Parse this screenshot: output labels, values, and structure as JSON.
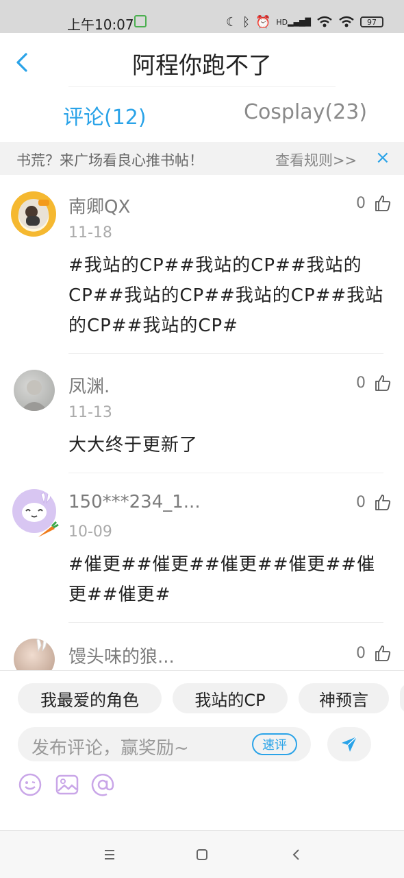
{
  "status_bar": {
    "time": "上午10:07",
    "battery": "97",
    "hd_label": "HD"
  },
  "header": {
    "title": "阿程你跑不了",
    "back_icon": "chevron-left-icon"
  },
  "tabs": [
    {
      "label": "评论(12)",
      "active": true
    },
    {
      "label": "Cosplay(23)",
      "active": false
    }
  ],
  "notice": {
    "text": "书荒？来广场看良心推书帖！",
    "link": "查看规则>>",
    "close": "×"
  },
  "comments": [
    {
      "user": "南卿QX",
      "date": "11-18",
      "likes": "0",
      "text": "#我站的CP##我站的CP##我站的CP##我站的CP##我站的CP##我站的CP##我站的CP#"
    },
    {
      "user": "凤渊.",
      "date": "11-13",
      "likes": "0",
      "text": "大大终于更新了"
    },
    {
      "user": "150***234_1...",
      "date": "10-09",
      "likes": "0",
      "text": "#催更##催更##催更##催更##催更##催更#"
    },
    {
      "user": "馒头味的狼...",
      "likes": "0"
    }
  ],
  "quick_tags": [
    "我最爱的角色",
    "我站的CP",
    "神预言"
  ],
  "composer": {
    "placeholder": "发布评论，赢奖励~",
    "quick_label": "速评"
  },
  "colors": {
    "accent": "#2aa3e8",
    "tool_icons": "#c9a6e8"
  }
}
